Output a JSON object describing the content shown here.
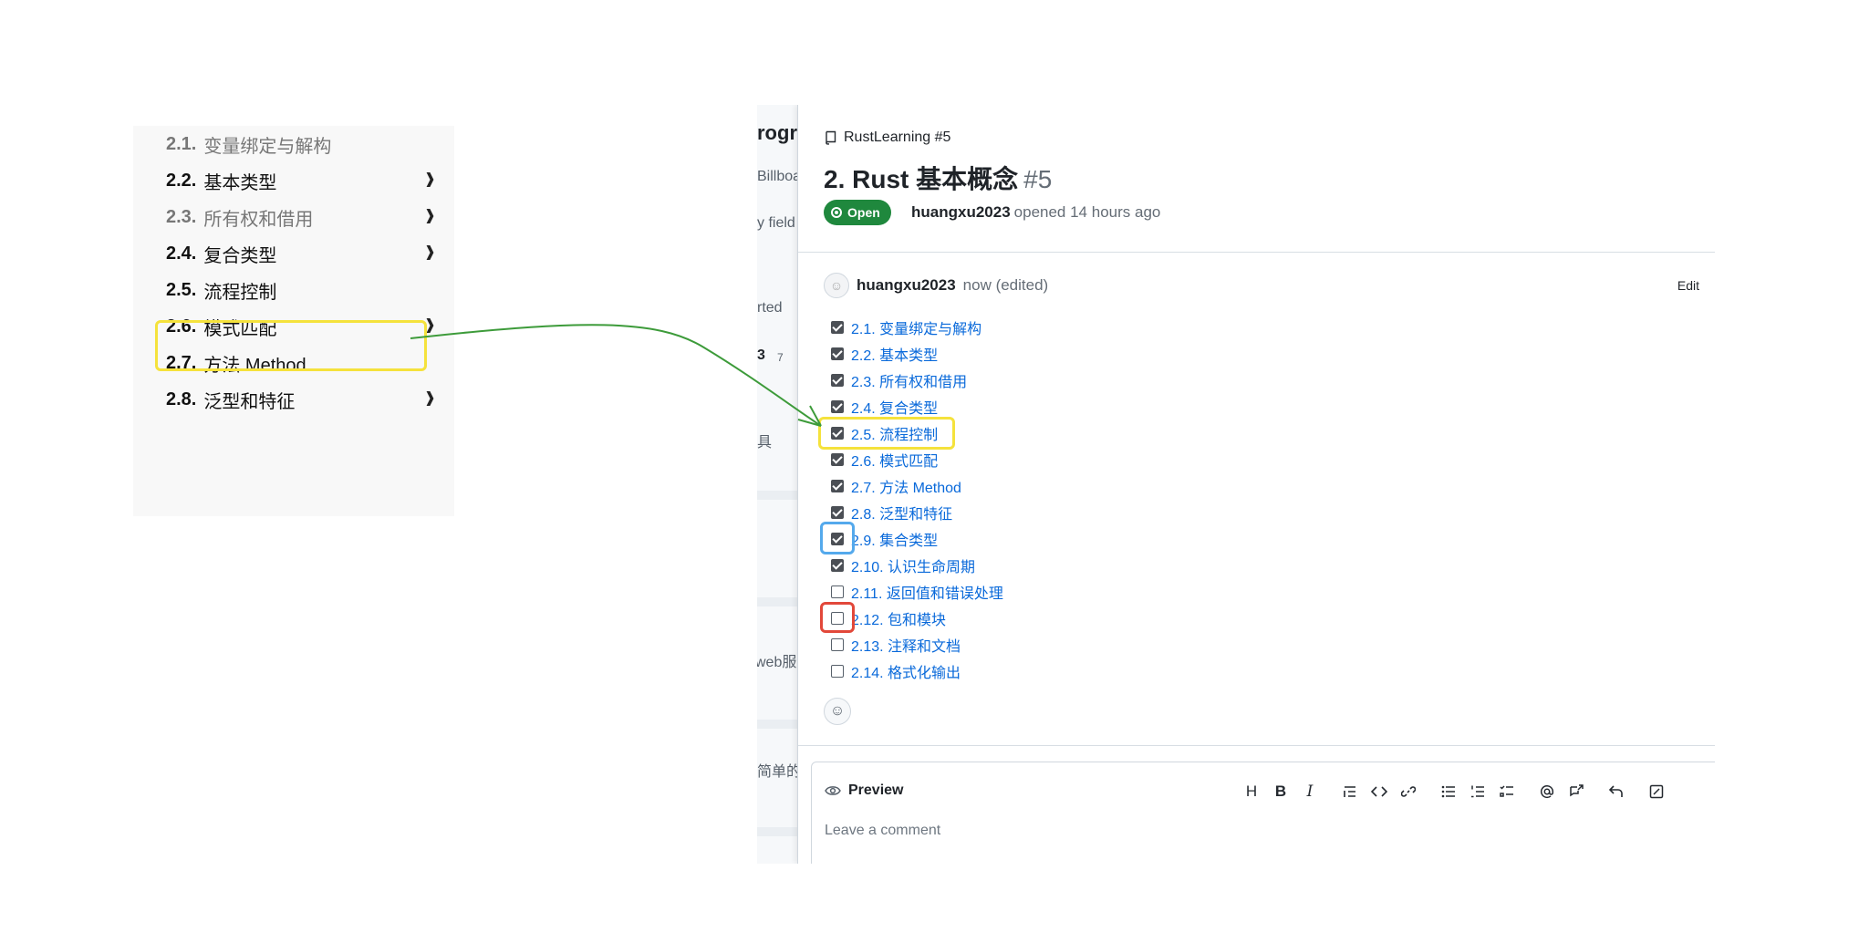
{
  "toc": {
    "items": [
      {
        "num": "2.1.",
        "label": "变量绑定与解构",
        "chevron": ""
      },
      {
        "num": "2.2.",
        "label": "基本类型",
        "chevron": "❱"
      },
      {
        "num": "2.3.",
        "label": "所有权和借用",
        "chevron": "❱"
      },
      {
        "num": "2.4.",
        "label": "复合类型",
        "chevron": "❱"
      },
      {
        "num": "2.5.",
        "label": "流程控制",
        "chevron": ""
      },
      {
        "num": "2.6.",
        "label": "模式匹配",
        "chevron": "❱"
      },
      {
        "num": "2.7.",
        "label": "方法 Method",
        "chevron": ""
      },
      {
        "num": "2.8.",
        "label": "泛型和特征",
        "chevron": "❱"
      }
    ]
  },
  "background": {
    "fragments": [
      "rogre",
      "Billboa",
      "y field",
      "rted",
      "3",
      "7",
      "具",
      "web服务",
      "简单的"
    ]
  },
  "issue": {
    "repo_ref": "RustLearning #5",
    "title": "2. Rust 基本概念",
    "number": "#5",
    "status": "Open",
    "author": "huangxu2023",
    "opened_text": "opened 14 hours ago"
  },
  "comment": {
    "author": "huangxu2023",
    "time": "now (edited)",
    "edit_label": "Edit",
    "tasks": [
      {
        "label": "2.1. 变量绑定与解构",
        "checked": true
      },
      {
        "label": "2.2. 基本类型",
        "checked": true
      },
      {
        "label": "2.3. 所有权和借用",
        "checked": true
      },
      {
        "label": "2.4. 复合类型",
        "checked": true
      },
      {
        "label": "2.5. 流程控制",
        "checked": true
      },
      {
        "label": "2.6. 模式匹配",
        "checked": true
      },
      {
        "label": "2.7. 方法 Method",
        "checked": true
      },
      {
        "label": "2.8. 泛型和特征",
        "checked": true
      },
      {
        "label": "2.9. 集合类型",
        "checked": true
      },
      {
        "label": "2.10. 认识生命周期",
        "checked": true
      },
      {
        "label": "2.11. 返回值和错误处理",
        "checked": false
      },
      {
        "label": "2.12. 包和模块",
        "checked": false
      },
      {
        "label": "2.13. 注释和文档",
        "checked": false
      },
      {
        "label": "2.14. 格式化输出",
        "checked": false
      }
    ]
  },
  "editor": {
    "preview_label": "Preview",
    "placeholder": "Leave a comment",
    "toolbar": [
      "H",
      "B",
      "I"
    ]
  },
  "icons": {
    "repo": "repo-icon",
    "eye": "eye-icon",
    "smiley": "smiley-icon"
  },
  "colors": {
    "highlight_yellow": "#f5e23c",
    "highlight_blue": "#54a9ec",
    "highlight_red": "#e2483a",
    "arrow_green": "#3d9b3a",
    "open_green": "#1f883d",
    "link_blue": "#0969da"
  }
}
